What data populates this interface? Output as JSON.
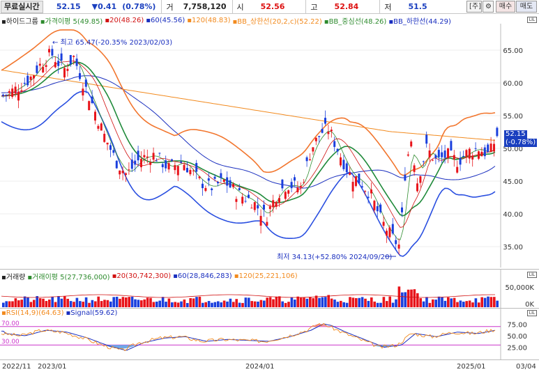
{
  "quote": {
    "title": "무료실시간",
    "price": "52.15",
    "change": "▼0.41",
    "change_pct": "(0.78%)",
    "volume_label": "거",
    "volume": "7,758,120",
    "open_label": "시",
    "open": "52.56",
    "high_label": "고",
    "high": "52.84",
    "low_label": "저",
    "low": "51.5",
    "btn_day": "[주]",
    "btn_settings": "⚙",
    "btn_buy": "매수",
    "btn_sell": "매도"
  },
  "price_panel": {
    "legend": [
      {
        "text": "하이드그룹",
        "color": "#222222"
      },
      {
        "text": "가격이평 5(49.85)",
        "color": "#2e8b2e"
      },
      {
        "text": "20(48.26)",
        "color": "#d11111"
      },
      {
        "text": "60(45.56)",
        "color": "#1a2fbf"
      },
      {
        "text": "120(48.83)",
        "color": "#f28a1e"
      },
      {
        "text": "BB_상한선(20,2,c)(52.22)",
        "color": "#f28a1e"
      },
      {
        "text": "BB_중심선(48.26)",
        "color": "#2e8b2e"
      },
      {
        "text": "BB_하한선(44.29)",
        "color": "#1a2fbf"
      }
    ],
    "high_annotation": "← 최고 65.47(-20.35% 2023/02/03)",
    "low_annotation": "최저 34.13(+52.80% 2024/09/20)",
    "last_price_flag": "52.15",
    "last_change_flag": "(-0.78%)",
    "y_ticks": [
      "65.00",
      "60.00",
      "55.00",
      "50.00",
      "45.00",
      "40.00",
      "35.00"
    ]
  },
  "volume_panel": {
    "legend": [
      {
        "text": "거래량",
        "color": "#222222"
      },
      {
        "text": "거래이평 5(27,736,000)",
        "color": "#2e8b2e"
      },
      {
        "text": "20(30,742,300)",
        "color": "#d11111"
      },
      {
        "text": "60(28,846,283)",
        "color": "#1a2fbf"
      },
      {
        "text": "120(25,221,106)",
        "color": "#f28a1e"
      }
    ],
    "y_ticks": [
      "50,000K",
      "0K"
    ]
  },
  "rsi_panel": {
    "legend": [
      {
        "text": "RSI(14,9)(64.63)",
        "color": "#f28a1e"
      },
      {
        "text": "Signal(59.62)",
        "color": "#1a2fbf"
      }
    ],
    "level_high": "70.00",
    "level_low": "30.00",
    "y_ticks": [
      "75.00",
      "50.00",
      "25.00"
    ]
  },
  "x_axis": [
    "2022/11",
    "2023/01",
    "2024/01",
    "2025/01",
    "03/04"
  ],
  "colors": {
    "up": "#e8131a",
    "down": "#1a3fdd",
    "accent_blue": "#1a3fbf"
  }
}
